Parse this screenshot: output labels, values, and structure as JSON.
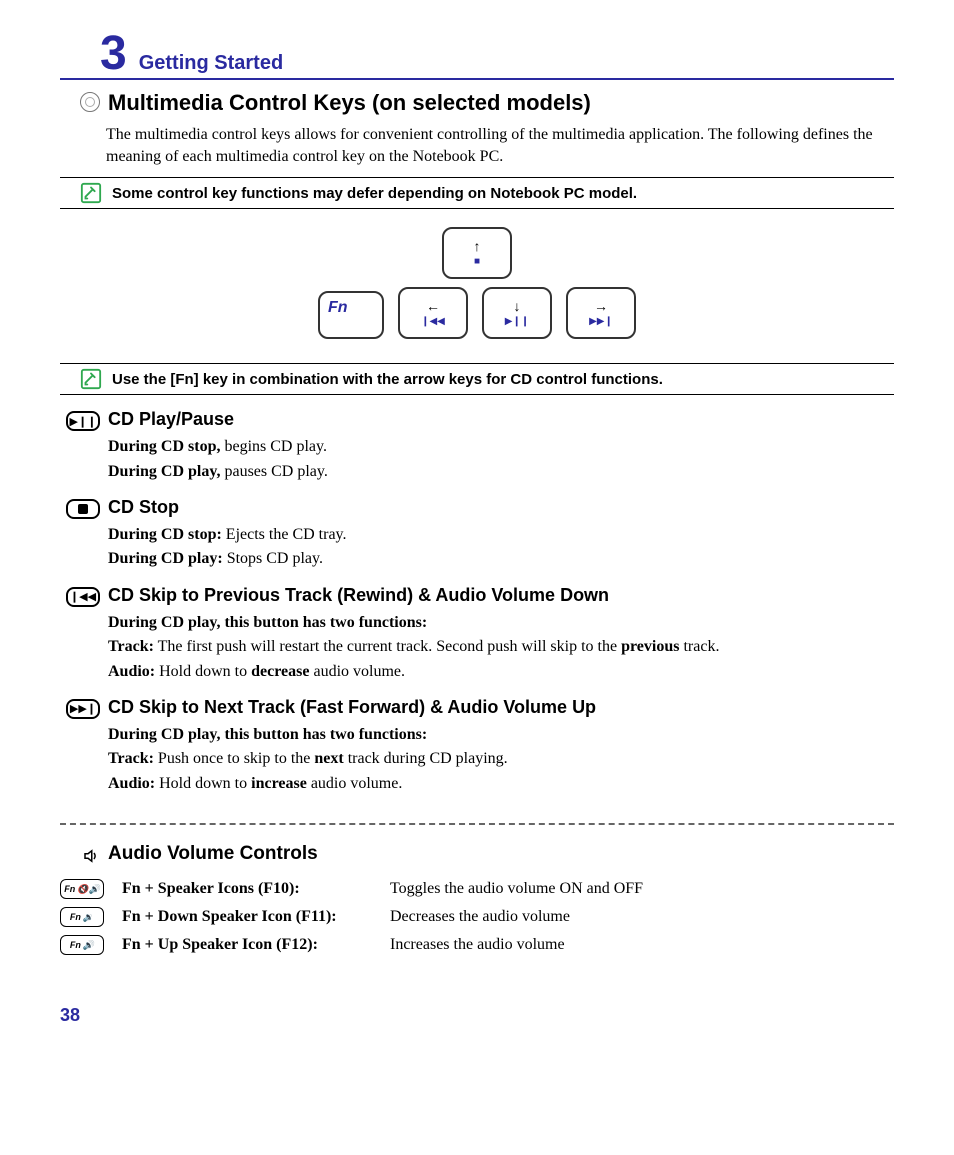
{
  "chapter": {
    "number": "3",
    "title": "Getting Started"
  },
  "section": {
    "title": "Multimedia Control Keys (on selected models)",
    "intro": "The multimedia control keys allows for convenient controlling of the multimedia application. The following defines the meaning of each multimedia control key on the Notebook PC."
  },
  "note1": "Some control key functions may defer depending on Notebook PC model.",
  "note2": "Use the [Fn] key in combination with the arrow keys for CD control functions.",
  "keys": {
    "fn": "Fn",
    "up_glyph": "■",
    "left_glyph": "❙◀◀",
    "down_glyph": "▶❙❙",
    "right_glyph": "▶▶❙"
  },
  "subs": {
    "play": {
      "title": "CD Play/Pause",
      "l1a": "During CD stop,",
      "l1b": " begins CD play.",
      "l2a": "During CD play,",
      "l2b": " pauses CD play."
    },
    "stop": {
      "title": "CD Stop",
      "l1a": "During CD stop:",
      "l1b": " Ejects the CD tray.",
      "l2a": "During CD play:",
      "l2b": " Stops CD play."
    },
    "prev": {
      "title": "CD Skip to Previous Track (Rewind) & Audio Volume Down",
      "lead": "During CD play, this button has two functions:",
      "t1a": "Track:",
      "t1b": " The first push will restart the current track. Second push will skip to the ",
      "t1c": "previous",
      "t1d": " track.",
      "a1a": "Audio:",
      "a1b": " Hold down to ",
      "a1c": "decrease",
      "a1d": " audio volume."
    },
    "next": {
      "title": "CD Skip to Next Track (Fast Forward) & Audio Volume Up",
      "lead": "During CD play, this button has two functions:",
      "t1a": "Track:",
      "t1b": " Push once to skip to the ",
      "t1c": "next",
      "t1d": " track during CD playing.",
      "a1a": "Audio:",
      "a1b": " Hold down to ",
      "a1c": "increase",
      "a1d": " audio volume."
    }
  },
  "audio": {
    "title": "Audio Volume Controls",
    "rows": [
      {
        "key_text": "Fn",
        "label": "Fn + Speaker Icons (F10):",
        "desc": "Toggles the audio volume ON and OFF"
      },
      {
        "key_text": "Fn",
        "label": "Fn + Down Speaker Icon (F11):",
        "desc": "Decreases the audio volume"
      },
      {
        "key_text": "Fn",
        "label": "Fn + Up Speaker Icon (F12):",
        "desc": "Increases the audio volume"
      }
    ]
  },
  "page": "38"
}
